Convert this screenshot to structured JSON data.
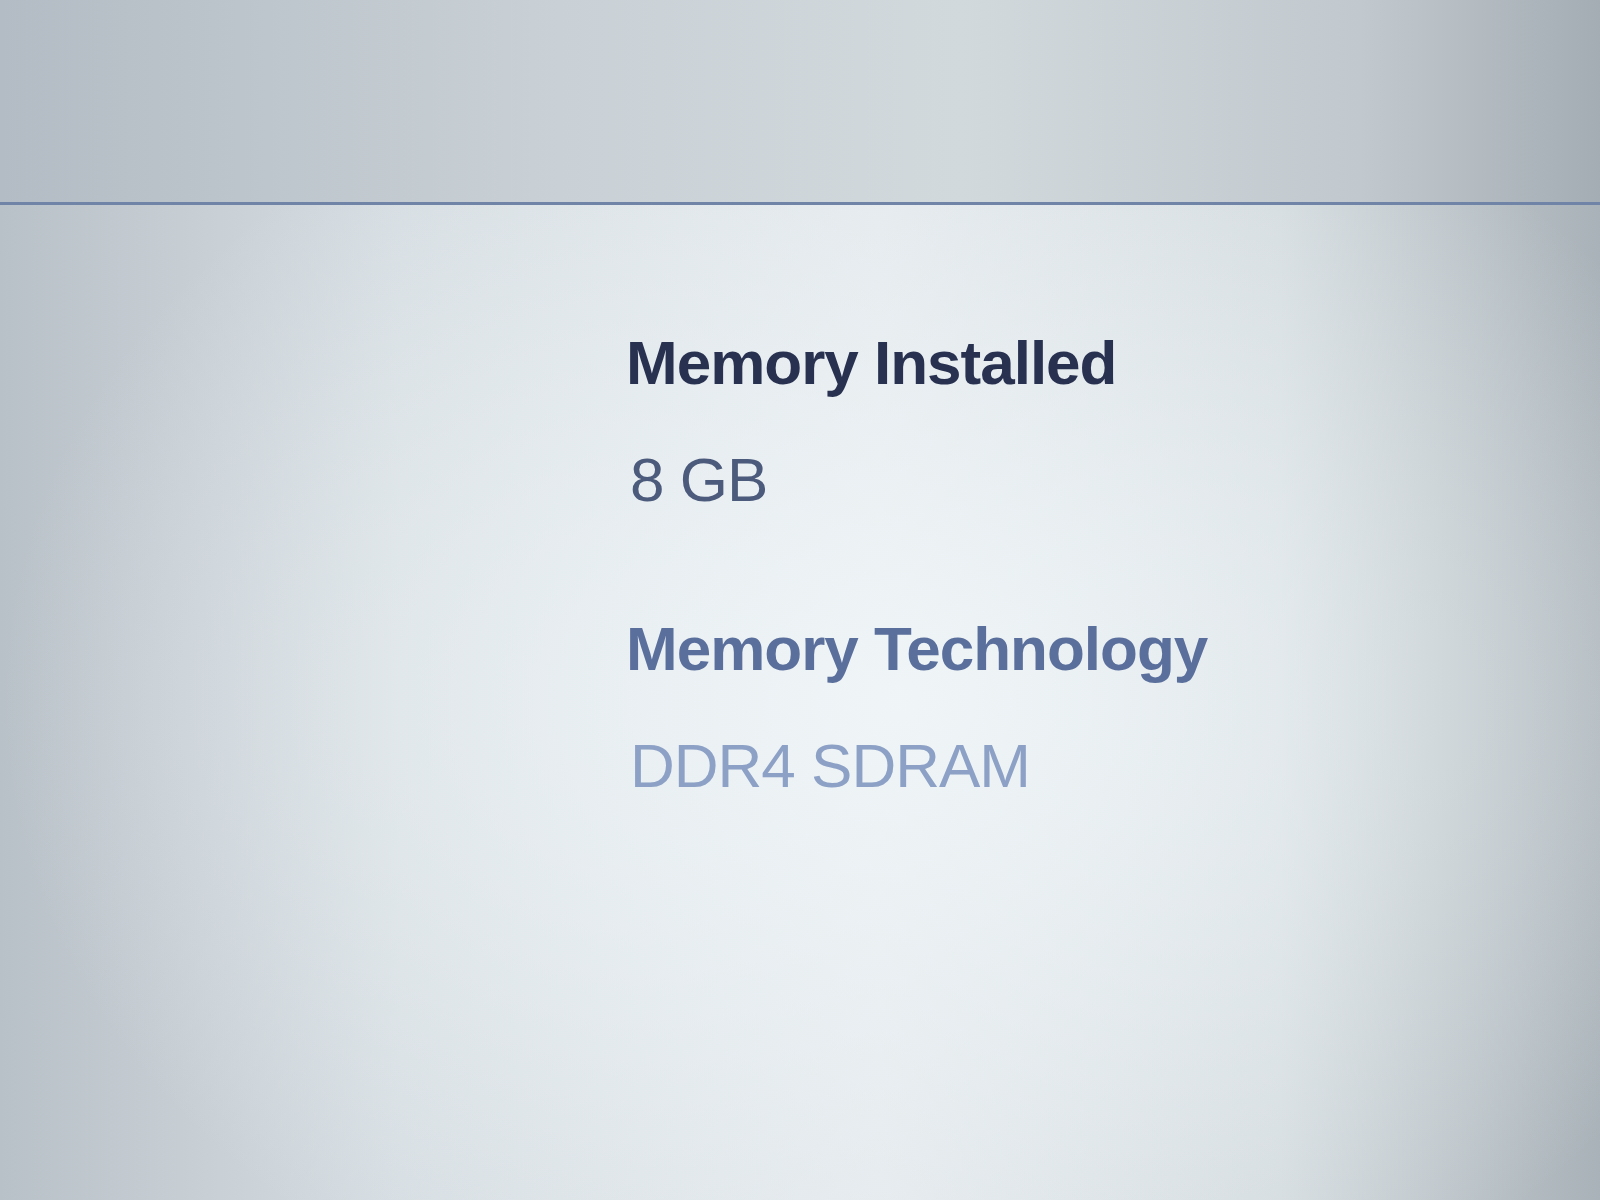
{
  "specs": [
    {
      "label": "Memory Installed",
      "value": "8 GB"
    },
    {
      "label": "Memory Technology",
      "value": "DDR4 SDRAM"
    }
  ]
}
